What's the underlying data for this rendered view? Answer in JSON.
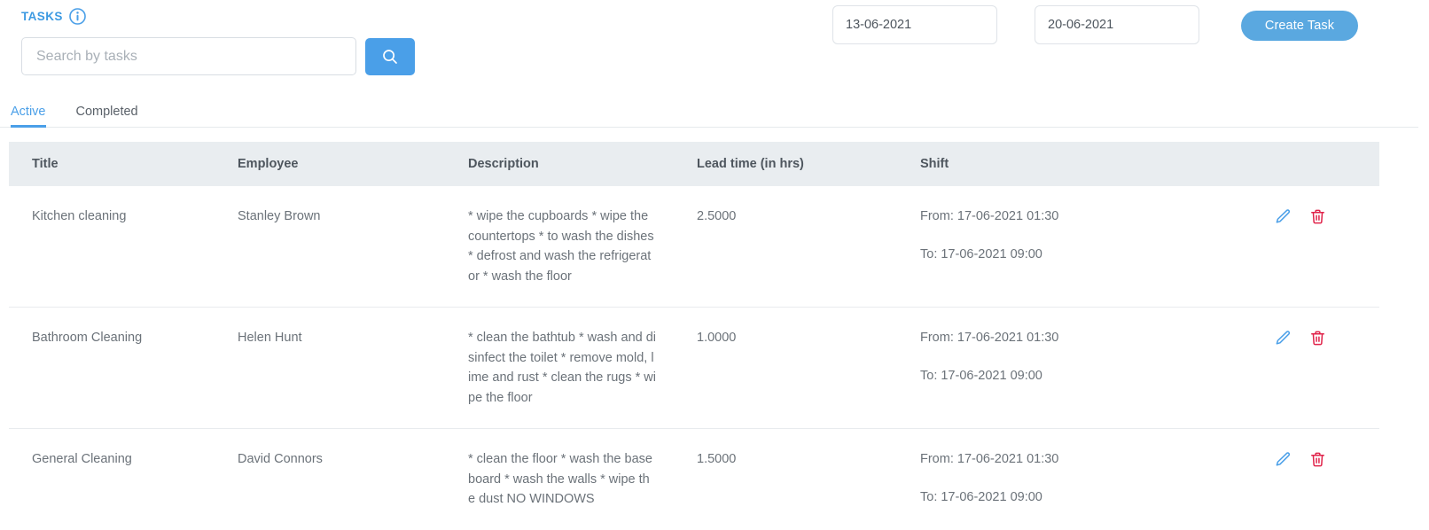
{
  "header": {
    "title": "TASKS",
    "info_icon": "info-circle-icon",
    "search": {
      "placeholder": "Search by tasks",
      "value": "",
      "button_icon": "search-icon"
    },
    "date_from": {
      "value": "13-06-2021",
      "placeholder": "dd-mm-yyyy"
    },
    "date_to": {
      "value": "20-06-2021",
      "placeholder": "dd-mm-yyyy"
    },
    "create_button": "Create Task"
  },
  "tabs": [
    {
      "label": "Active",
      "active": true
    },
    {
      "label": "Completed",
      "active": false
    }
  ],
  "table": {
    "columns": [
      "Title",
      "Employee",
      "Description",
      "Lead time (in hrs)",
      "Shift",
      ""
    ],
    "rows": [
      {
        "title": "Kitchen cleaning",
        "employee": "Stanley Brown",
        "description": "* wipe the cupboards * wipe the countertops * to wash the dishes * defrost and wash the refrigerator * wash the floor",
        "lead_time": "2.5000",
        "shift_from": "From: 17-06-2021 01:30",
        "shift_to": "To: 17-06-2021 09:00",
        "edit_icon": "pencil-icon",
        "delete_icon": "trash-icon"
      },
      {
        "title": "Bathroom Cleaning",
        "employee": "Helen Hunt",
        "description": "* clean the bathtub * wash and disinfect the toilet * remove mold, lime and rust * clean the rugs * wipe the floor",
        "lead_time": "1.0000",
        "shift_from": "From: 17-06-2021 01:30",
        "shift_to": "To: 17-06-2021 09:00",
        "edit_icon": "pencil-icon",
        "delete_icon": "trash-icon"
      },
      {
        "title": "General Cleaning",
        "employee": "David Connors",
        "description": "* clean the floor * wash the base board * wash the walls * wipe the dust NO WINDOWS",
        "lead_time": "1.5000",
        "shift_from": "From: 17-06-2021 01:30",
        "shift_to": "To: 17-06-2021 09:00",
        "edit_icon": "pencil-icon",
        "delete_icon": "trash-icon"
      }
    ]
  },
  "colors": {
    "accent": "#4a9fe8",
    "header_bg": "#e9edf0",
    "edit_icon": "#4a9fe8",
    "delete_icon": "#e0234a",
    "text": "#6b7279"
  }
}
